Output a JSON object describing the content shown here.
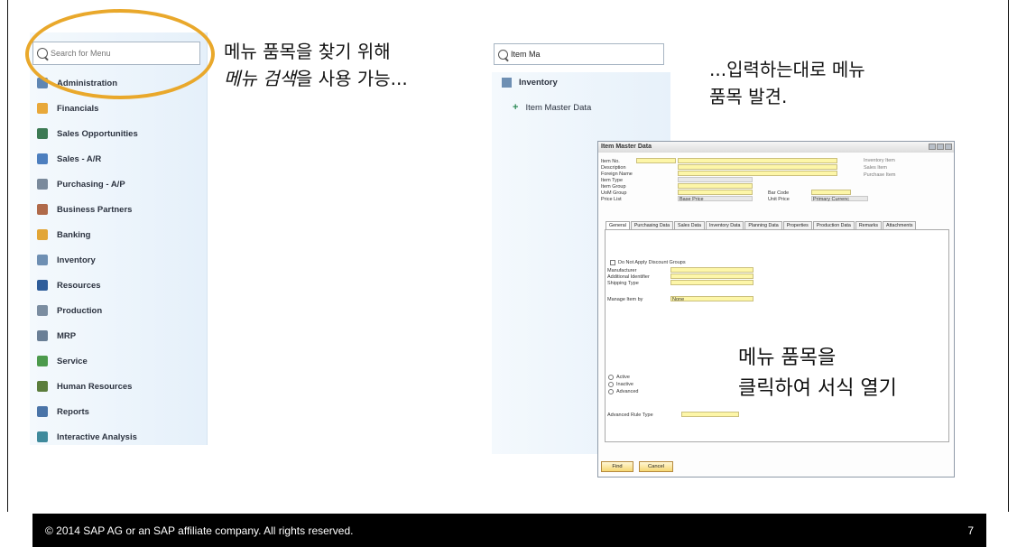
{
  "left_menu": {
    "search_placeholder": "Search for Menu",
    "items": [
      {
        "label": "Administration",
        "icon": "administration-icon",
        "color": "#5f86b3"
      },
      {
        "label": "Financials",
        "icon": "financials-icon",
        "color": "#e8a83a"
      },
      {
        "label": "Sales Opportunities",
        "icon": "sales-opportunities-icon",
        "color": "#3c7a54"
      },
      {
        "label": "Sales - A/R",
        "icon": "sales-ar-icon",
        "color": "#4d7fbf"
      },
      {
        "label": "Purchasing - A/P",
        "icon": "purchasing-ap-icon",
        "color": "#7a8a9c"
      },
      {
        "label": "Business Partners",
        "icon": "business-partners-icon",
        "color": "#b06a4a"
      },
      {
        "label": "Banking",
        "icon": "banking-icon",
        "color": "#e2a637"
      },
      {
        "label": "Inventory",
        "icon": "inventory-icon",
        "color": "#6e8fb3"
      },
      {
        "label": "Resources",
        "icon": "resources-icon",
        "color": "#2f5d9a"
      },
      {
        "label": "Production",
        "icon": "production-icon",
        "color": "#7b8da1"
      },
      {
        "label": "MRP",
        "icon": "mrp-icon",
        "color": "#6a7f96"
      },
      {
        "label": "Service",
        "icon": "service-icon",
        "color": "#4c9a4c"
      },
      {
        "label": "Human Resources",
        "icon": "human-resources-icon",
        "color": "#5b7d3c"
      },
      {
        "label": "Reports",
        "icon": "reports-icon",
        "color": "#4a74a8"
      },
      {
        "label": "Interactive Analysis",
        "icon": "interactive-analysis-icon",
        "color": "#3f8a9c"
      }
    ]
  },
  "annotations": {
    "a1_line1": "메뉴 품목을 찾기 위해",
    "a1_line2_italic": "메뉴 검색",
    "a1_line2_rest": "을 사용 가능...",
    "a2_line1": "...입력하는대로 메뉴",
    "a2_line2": "품목 발견.",
    "a3_line1": "메뉴 품목을",
    "a3_line2": "클릭하여 서식 열기"
  },
  "mid_menu": {
    "search_value": "Item Ma",
    "inventory_label": "Inventory",
    "item_master_label": "Item Master Data"
  },
  "window": {
    "title": "Item Master Data",
    "fields": {
      "item_no": "Item No.",
      "description": "Description",
      "foreign_name": "Foreign Name",
      "item_type": "Item Type",
      "item_group": "Item Group",
      "uom_group": "UoM Group",
      "price_list": "Price List",
      "price_list_value": "Base Price",
      "bar_code": "Bar Code",
      "unit_price": "Unit Price",
      "unit_price_value": "Primary Currenc",
      "inventory_item": "Inventory Item",
      "sales_item": "Sales Item",
      "purchase_item": "Purchase Item"
    },
    "tabs": [
      "General",
      "Purchasing Data",
      "Sales Data",
      "Inventory Data",
      "Planning Data",
      "Properties",
      "Production Data",
      "Remarks",
      "Attachments"
    ],
    "general": {
      "do_not_apply": "Do Not Apply Discount Groups",
      "manufacturer": "Manufacturer",
      "additional_identifier": "Additional Identifier",
      "shipping_type": "Shipping Type",
      "manage_item_by": "Manage Item by",
      "manage_item_value": "None",
      "active": "Active",
      "inactive": "Inactive",
      "advanced": "Advanced",
      "advanced_rule_type": "Advanced Rule Type"
    },
    "buttons": {
      "find": "Find",
      "cancel": "Cancel"
    }
  },
  "footer": {
    "copyright": "© 2014 SAP AG or an SAP affiliate company. All rights reserved.",
    "page_number": "7"
  },
  "colors": {
    "highlight": "#e9a82b",
    "footer_bg": "#000000",
    "field_yellow": "#fdf6a8"
  }
}
